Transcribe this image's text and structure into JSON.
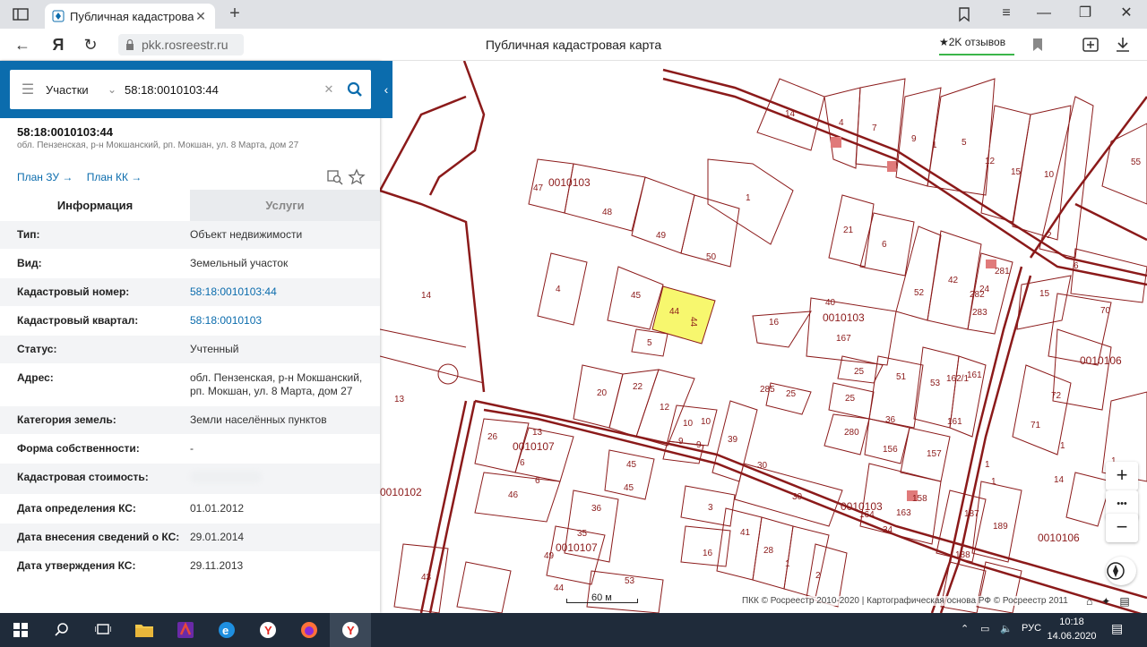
{
  "browser": {
    "tab_title": "Публичная кадастровая",
    "url": "pkk.rosreestr.ru",
    "page_title": "Публичная кадастровая карта",
    "reviews": "★2K отзывов"
  },
  "search": {
    "type": "Участки",
    "query": "58:18:0010103:44"
  },
  "object": {
    "cad_number": "58:18:0010103:44",
    "address_short": "обл. Пензенская, р-н Мокшанский, рп. Мокшан, ул. 8 Марта, дом 27",
    "links": [
      "План ЗУ →",
      "План КК →"
    ]
  },
  "tabs": [
    "Информация",
    "Услуги"
  ],
  "info_rows": [
    {
      "key": "Тип:",
      "value": "Объект недвижимости",
      "link": false
    },
    {
      "key": "Вид:",
      "value": "Земельный участок",
      "link": false
    },
    {
      "key": "Кадастровый номер:",
      "value": "58:18:0010103:44",
      "link": true
    },
    {
      "key": "Кадастровый квартал:",
      "value": "58:18:0010103",
      "link": true
    },
    {
      "key": "Статус:",
      "value": "Учтенный",
      "link": false
    },
    {
      "key": "Адрес:",
      "value": "обл. Пензенская, р-н Мокшанский, рп. Мокшан, ул. 8 Марта, дом 27",
      "link": false
    },
    {
      "key": "Категория земель:",
      "value": "Земли населённых пунктов",
      "link": false
    },
    {
      "key": "Форма собственности:",
      "value": "-",
      "link": false
    },
    {
      "key": "Кадастровая стоимость:",
      "value": "",
      "link": false,
      "hidden": true
    },
    {
      "key": "Дата определения КС:",
      "value": "01.01.2012",
      "link": false
    },
    {
      "key": "Дата внесения сведений о КС:",
      "value": "29.01.2014",
      "link": false
    },
    {
      "key": "Дата утверждения КС:",
      "value": "29.11.2013",
      "link": false
    }
  ],
  "map": {
    "quarters": [
      "0010103",
      "0010103",
      "0010106",
      "0010107",
      "0010107",
      "0010102",
      "0010103",
      "0010106"
    ],
    "scale": "60 м",
    "copyright": "ПКК © Росреестр 2010-2020 | Картографическая основа РФ © Росреестр 2011",
    "controls": {
      "zoom_in": "+",
      "more": "•••",
      "zoom_out": "−"
    }
  },
  "taskbar": {
    "lang": "РУС",
    "time": "10:18",
    "date": "14.06.2020"
  },
  "colors": {
    "panel_header": "#0b6cad",
    "parcel_line": "#8b1a1a",
    "selected_parcel": "#f7f76e",
    "taskbar": "#1f2b3a"
  }
}
